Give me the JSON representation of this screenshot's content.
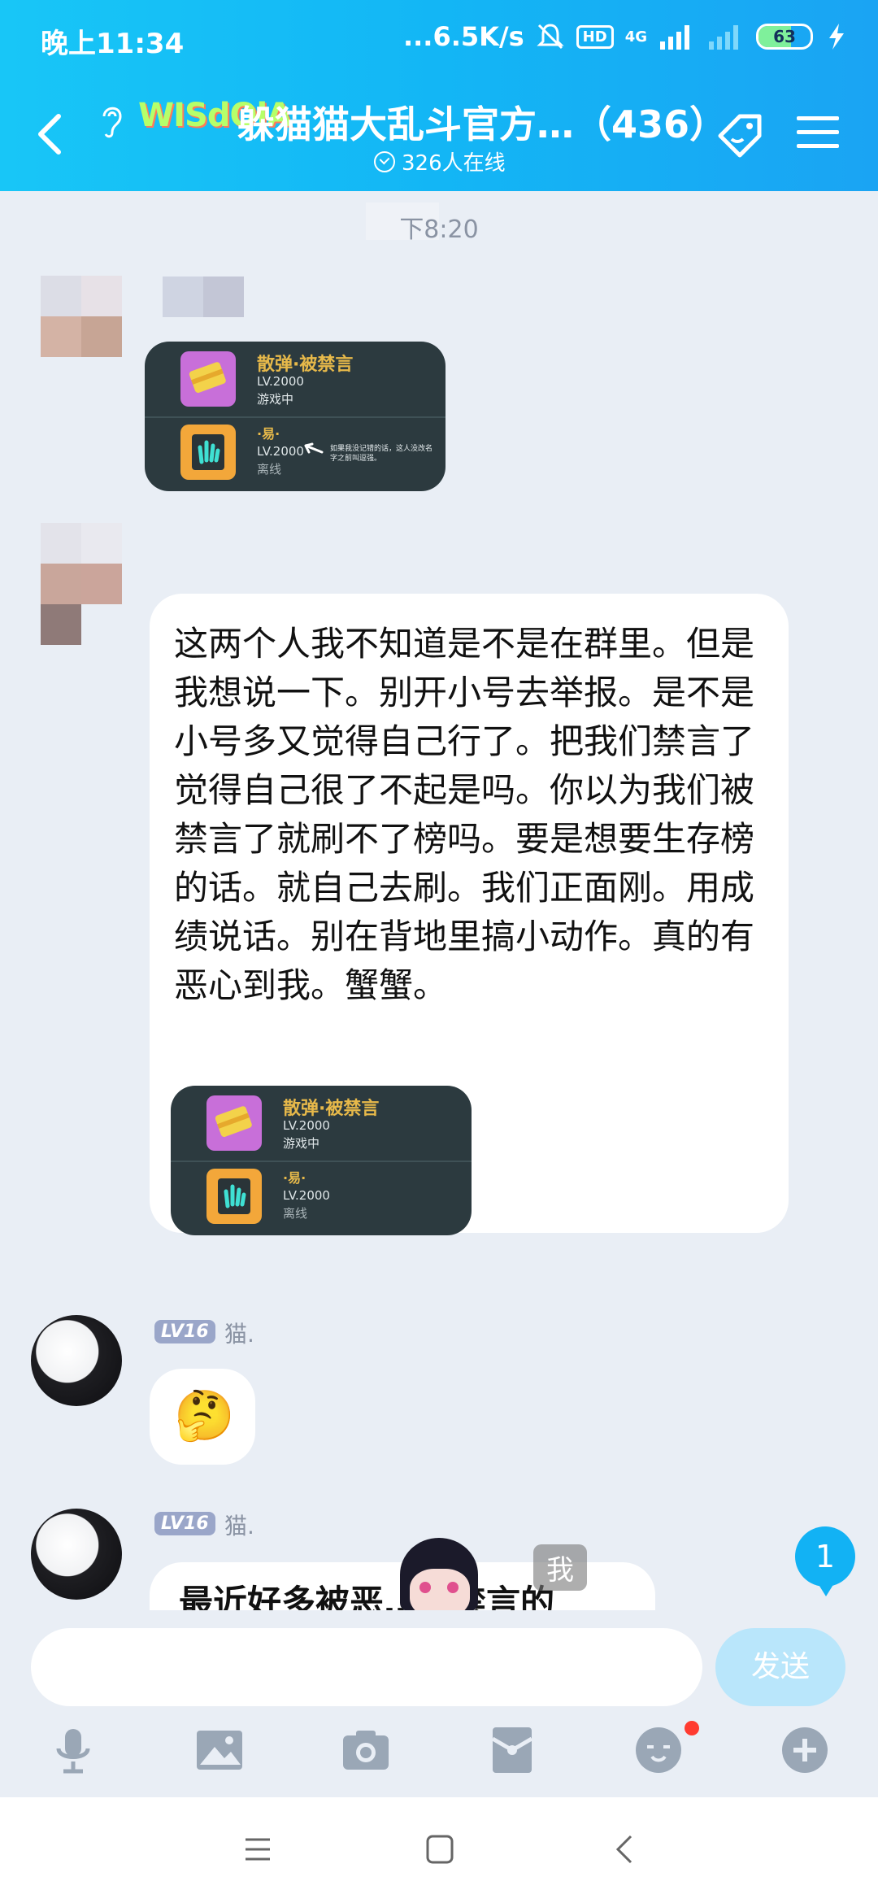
{
  "status_bar": {
    "time": "晚上11:34",
    "network_speed": "...6.5K/s",
    "hd": "HD",
    "signal_type": "4G",
    "battery": "63"
  },
  "header": {
    "logo_text": "WISdOlA",
    "title": "躲猫猫大乱斗官方…（436）",
    "online": "326人在线"
  },
  "chat": {
    "timestamp": "下8:20",
    "messages": [
      {
        "image": {
          "row1_title": "散弹·被禁言",
          "row1_level": "LV.2000",
          "row1_status": "游戏中",
          "row2_title": "·易·",
          "row2_level": "LV.2000",
          "row2_status": "离线",
          "annotation": "如果我没记错的话，这人没改名字之前叫逗强。"
        }
      },
      {
        "text": "这两个人我不知道是不是在群里。但是我想说一下。别开小号去举报。是不是小号多又觉得自己行了。把我们禁言了觉得自己很了不起是吗。你以为我们被禁言了就刷不了榜吗。要是想要生存榜的话。就自己去刷。我们正面刚。用成绩说话。别在背地里搞小动作。真的有恶心到我。蟹蟹。",
        "image": {
          "row1_title": "散弹·被禁言",
          "row1_level": "LV.2000",
          "row1_status": "游戏中",
          "row2_title": "·易·",
          "row2_level": "LV.2000",
          "row2_status": "离线"
        }
      },
      {
        "level": "LV16",
        "nick": "猫.",
        "emoji": "🤔"
      },
      {
        "level": "LV16",
        "nick": "猫.",
        "text": "最近好多被恶…报禁言的",
        "sticker_label": "我"
      }
    ],
    "unread_count": "1"
  },
  "input_bar": {
    "placeholder": "",
    "send_label": "发送"
  },
  "colors": {
    "header_start": "#18c6f7",
    "header_end": "#1aa4f3",
    "chat_bg": "#e9eef5",
    "accent": "#12b2f4"
  }
}
